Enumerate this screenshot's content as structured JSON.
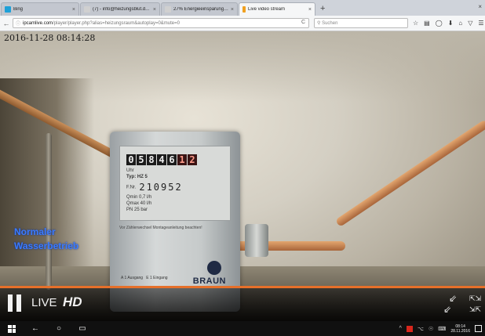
{
  "browser": {
    "tabs": [
      {
        "label": "Bing",
        "favicon_color": "#1ea0d8",
        "active": false
      },
      {
        "label": "(7) - info@heizungsblut.d...",
        "favicon_color": "#d0d0d0",
        "active": false
      },
      {
        "label": "27% Energieeinsparung - Heiz...",
        "favicon_color": "#d0d0d0",
        "active": false
      },
      {
        "label": "Live video stream",
        "favicon_color": "#f0a020",
        "active": true
      }
    ],
    "new_tab_icon": "+",
    "close_window_icon": "×",
    "tab_close_icon": "×",
    "url_host": "ipcamlive.com",
    "url_path": "/player/player.php?alias=heizungsraum&autoplay=0&mute=0",
    "reload_icon": "C",
    "search_placeholder": "Suchen",
    "toolbar_icons": [
      "star-icon",
      "reading-list-icon",
      "pocket-icon",
      "download-icon",
      "home-icon",
      "shield-icon",
      "menu-icon"
    ]
  },
  "video": {
    "timestamp": "2016-11-28 08:14:28",
    "overlay_line1": "Normaler",
    "overlay_line2": "Wasserbetrieb",
    "meter": {
      "digits": [
        "0",
        "5",
        "8",
        "4",
        "6",
        "1",
        "2"
      ],
      "label_uhr": "Uhr",
      "type_label": "Typ: HZ 5",
      "fnr_label": "F.Nr.",
      "fnr_value": "210952",
      "qmin": "Qmin 0,7 l/h",
      "qmax": "Qmax 40 l/h",
      "pn": "PN 25 bar",
      "lower_text": "Vor Zählerwechsel Montageanleitung beachten!",
      "a_label": "A 1 Ausgang",
      "e_label": "E 1 Eingang",
      "brand": "BRAUN"
    },
    "controls": {
      "live_label": "LIVE",
      "hd_label": "HD",
      "accent_color": "#e6702a"
    }
  },
  "taskbar": {
    "time": "08:14",
    "date": "28.11.2016"
  }
}
